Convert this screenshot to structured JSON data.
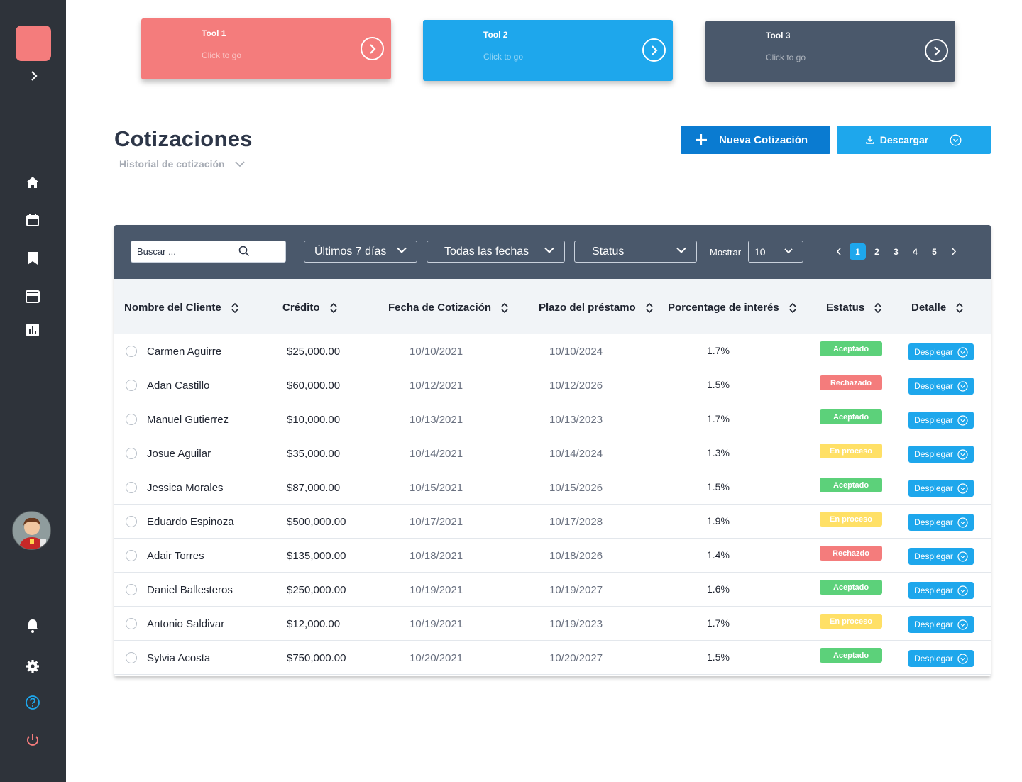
{
  "tools": [
    {
      "title": "Tool 1",
      "subtitle": "Click to go",
      "color": "#f47c7c"
    },
    {
      "title": "Tool 2",
      "subtitle": "Click to go",
      "color": "#1ea7ec"
    },
    {
      "title": "Tool 3",
      "subtitle": "Click to go",
      "color": "#4a586b"
    }
  ],
  "sidebar": {
    "nav": [
      "home-icon",
      "calendar-icon",
      "bookmark-icon",
      "card-icon",
      "chart-icon"
    ],
    "bottom": [
      "bell-icon",
      "gear-icon",
      "help-icon",
      "power-icon"
    ]
  },
  "header": {
    "title": "Cotizaciones",
    "subtitle": "Historial de cotización",
    "new_label": "Nueva Cotización",
    "download_label": "Descargar"
  },
  "filters": {
    "search_placeholder": "Buscar ...",
    "range": "Últimos 7 días",
    "dates": "Todas las fechas",
    "status": "Status",
    "show_label": "Mostrar",
    "show_value": "10",
    "pages": [
      "1",
      "2",
      "3",
      "4",
      "5"
    ],
    "current_page": "1"
  },
  "columns": [
    "Nombre del Cliente",
    "Crédito",
    "Fecha de Cotización",
    "Plazo del préstamo",
    "Porcentage de interés",
    "Estatus",
    "Detalle"
  ],
  "detail_label": "Desplegar",
  "status_colors": {
    "Aceptado": "#5cd17a",
    "Rechazado": "#f47c7c",
    "Rechazdo": "#f47c7c",
    "En proceso": "#ffe066"
  },
  "rows": [
    {
      "name": "Carmen Aguirre",
      "credit": "$25,000.00",
      "date": "10/10/2021",
      "term": "10/10/2024",
      "rate": "1.7%",
      "status": "Aceptado"
    },
    {
      "name": "Adan Castillo",
      "credit": "$60,000.00",
      "date": "10/12/2021",
      "term": "10/12/2026",
      "rate": "1.5%",
      "status": "Rechazado"
    },
    {
      "name": "Manuel Gutierrez",
      "credit": "$10,000.00",
      "date": "10/13/2021",
      "term": "10/13/2023",
      "rate": "1.7%",
      "status": "Aceptado"
    },
    {
      "name": "Josue Aguilar",
      "credit": "$35,000.00",
      "date": "10/14/2021",
      "term": "10/14/2024",
      "rate": "1.3%",
      "status": "En proceso"
    },
    {
      "name": "Jessica Morales",
      "credit": "$87,000.00",
      "date": "10/15/2021",
      "term": "10/15/2026",
      "rate": "1.5%",
      "status": "Aceptado"
    },
    {
      "name": "Eduardo Espinoza",
      "credit": "$500,000.00",
      "date": "10/17/2021",
      "term": "10/17/2028",
      "rate": "1.9%",
      "status": "En proceso"
    },
    {
      "name": "Adair Torres",
      "credit": "$135,000.00",
      "date": "10/18/2021",
      "term": "10/18/2026",
      "rate": "1.4%",
      "status": "Rechazdo"
    },
    {
      "name": "Daniel Ballesteros",
      "credit": "$250,000.00",
      "date": "10/19/2021",
      "term": "10/19/2027",
      "rate": "1.6%",
      "status": "Aceptado"
    },
    {
      "name": "Antonio Saldivar",
      "credit": "$12,000.00",
      "date": "10/19/2021",
      "term": "10/19/2023",
      "rate": "1.7%",
      "status": "En proceso"
    },
    {
      "name": "Sylvia Acosta",
      "credit": "$750,000.00",
      "date": "10/20/2021",
      "term": "10/20/2027",
      "rate": "1.5%",
      "status": "Aceptado"
    }
  ]
}
